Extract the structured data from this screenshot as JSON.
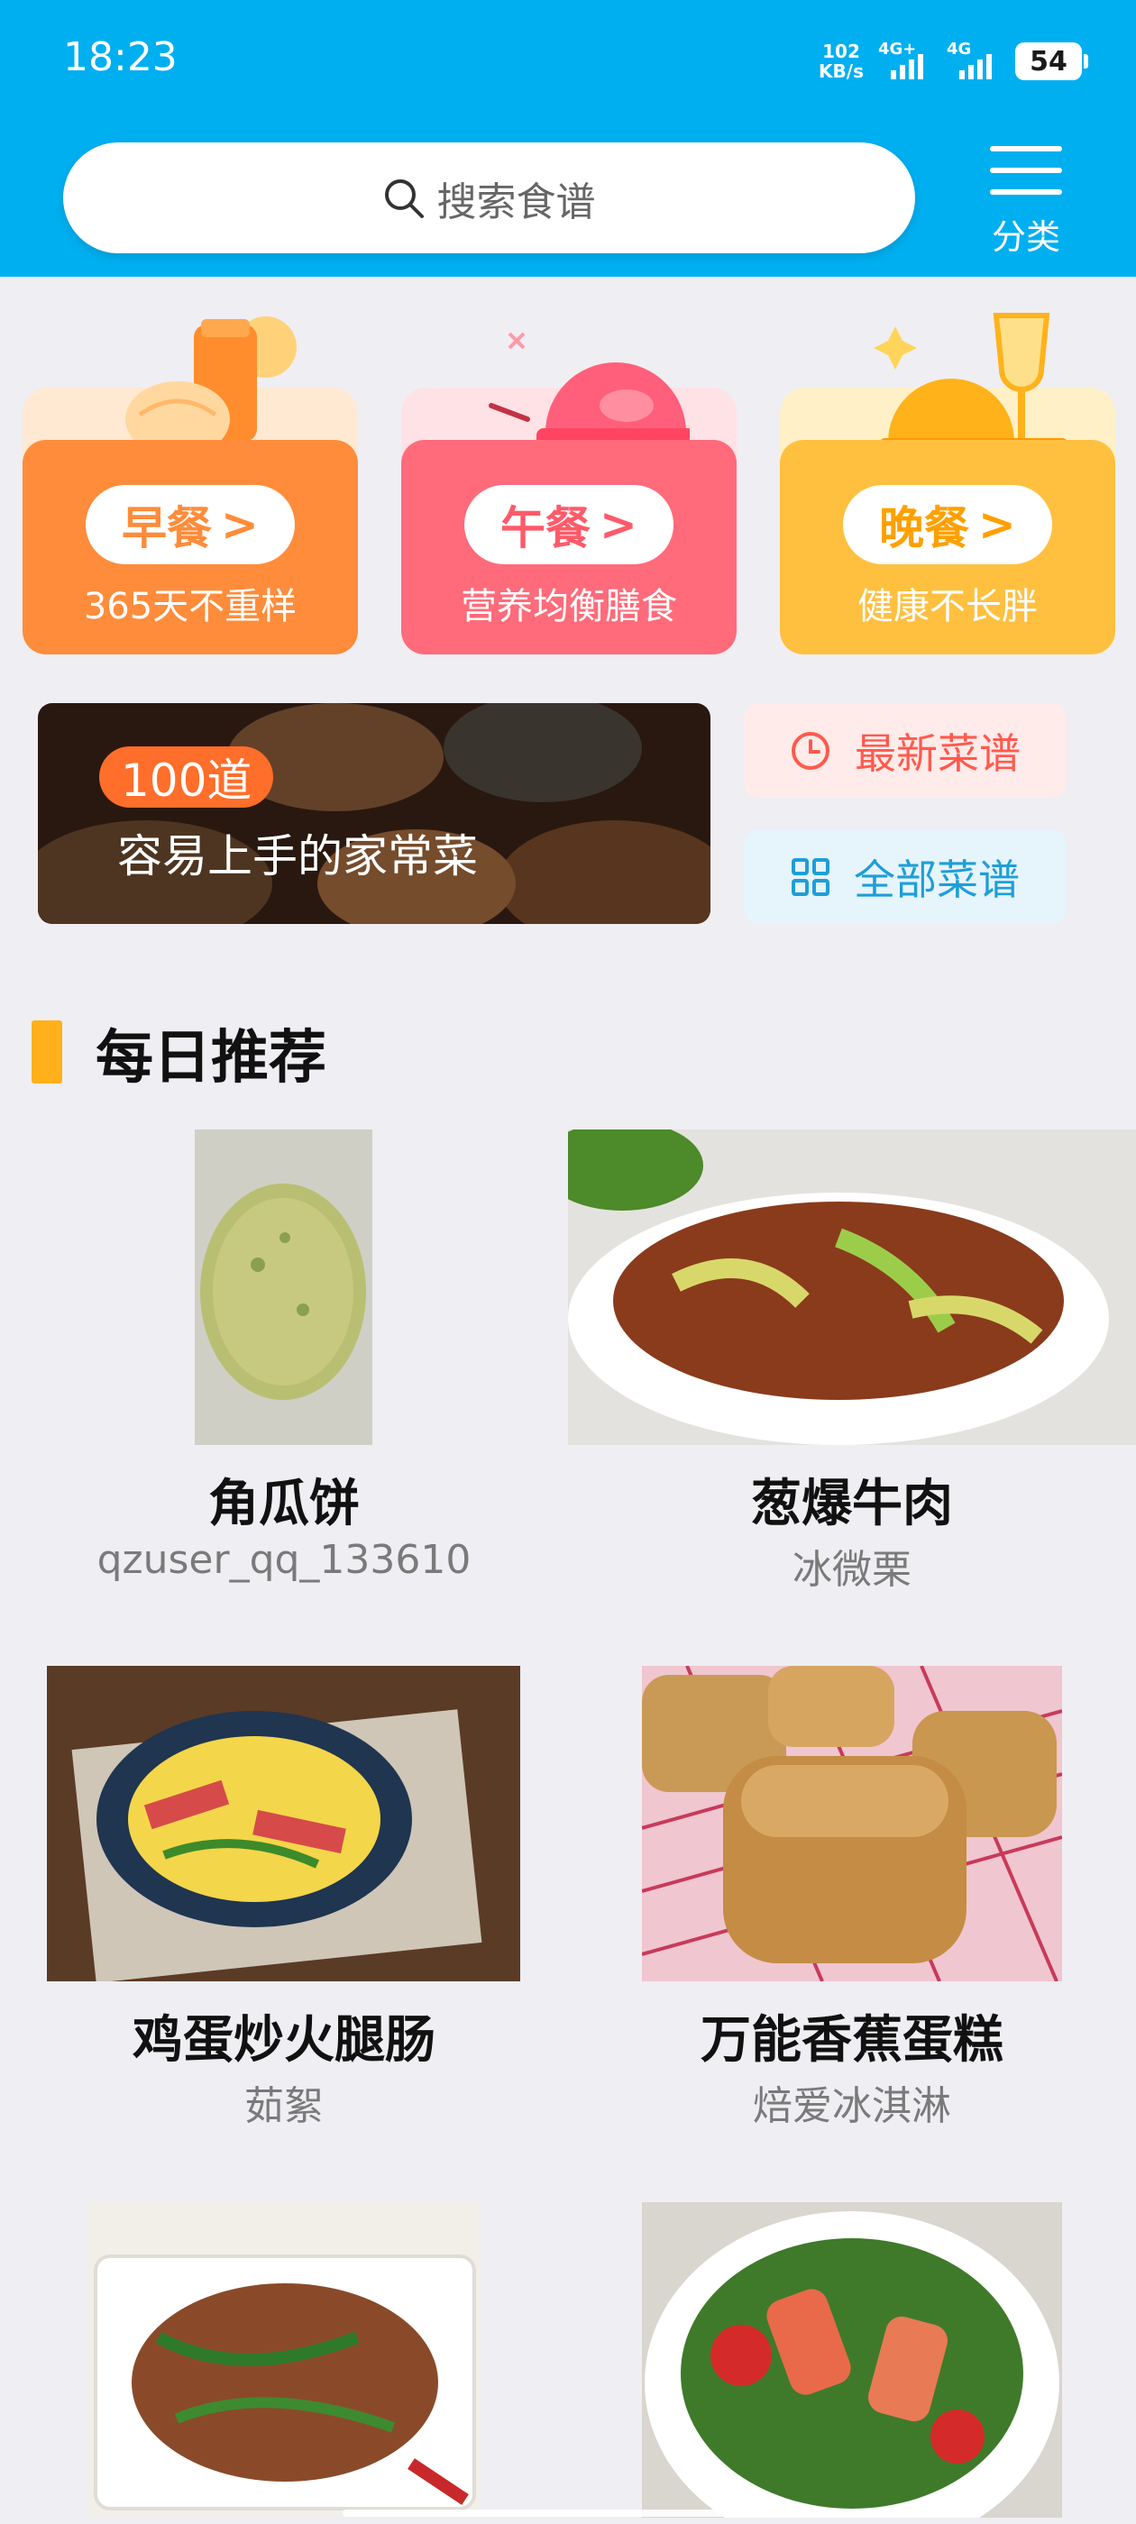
{
  "status_bar": {
    "time": "18:23",
    "net_speed_value": "102",
    "net_speed_unit": "KB/s",
    "net1": "4G+",
    "net2": "4G",
    "battery": "54"
  },
  "header": {
    "search_placeholder": "搜索食谱",
    "menu_label": "分类"
  },
  "meals": [
    {
      "label": "早餐",
      "subtitle": "365天不重样",
      "accent": "#ff8c3b",
      "back": "#ffe9d3"
    },
    {
      "label": "午餐",
      "subtitle": "营养均衡膳食",
      "accent": "#ff6b7a",
      "back": "#ffe2e6"
    },
    {
      "label": "晚餐",
      "subtitle": "健康不长胖",
      "accent": "#ffc040",
      "back": "#fff0c8"
    }
  ],
  "banner": {
    "badge": "100道",
    "title": "容易上手的家常菜"
  },
  "quick_links": {
    "latest": "最新菜谱",
    "all": "全部菜谱"
  },
  "section": {
    "title": "每日推荐"
  },
  "recipes": [
    {
      "name": "角瓜饼",
      "author": "qzuser_qq_133610"
    },
    {
      "name": "葱爆牛肉",
      "author": "冰微栗"
    },
    {
      "name": "鸡蛋炒火腿肠",
      "author": "茹絮"
    },
    {
      "name": "万能香蕉蛋糕",
      "author": "焙爱冰淇淋"
    },
    {
      "name": "",
      "author": ""
    },
    {
      "name": "",
      "author": ""
    }
  ],
  "colors": {
    "header": "#00aff0",
    "background": "#efeef3",
    "section_bar": "#ffb01a"
  }
}
